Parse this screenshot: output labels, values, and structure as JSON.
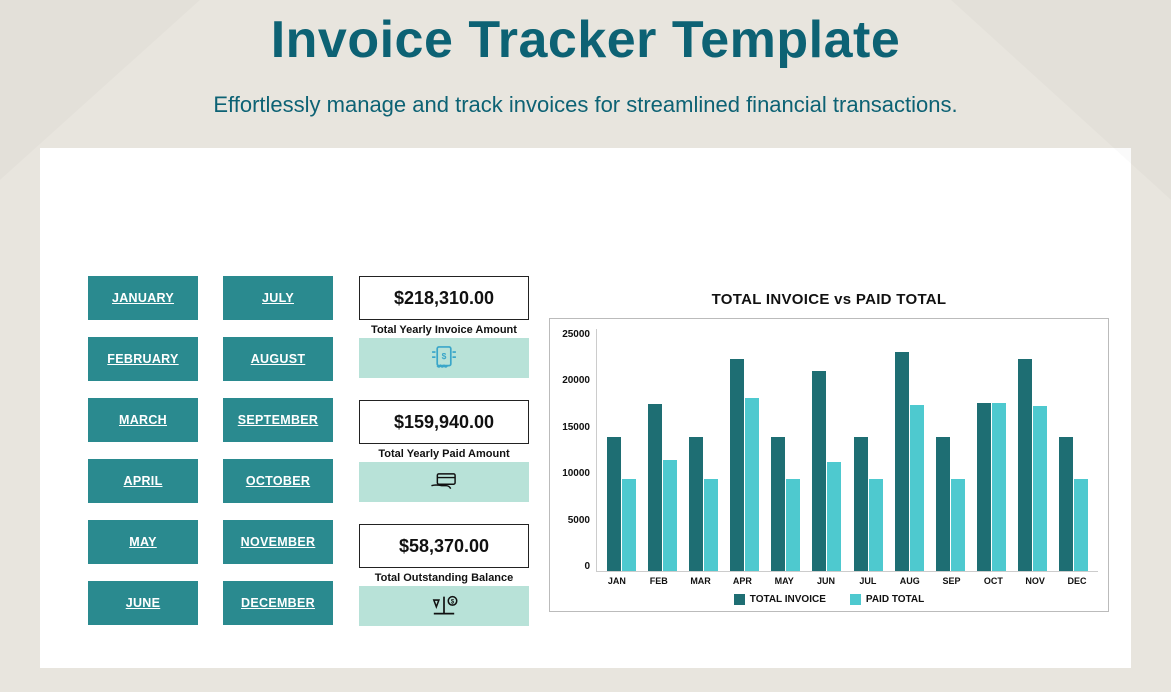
{
  "header": {
    "title": "Invoice Tracker Template",
    "subtitle": "Effortlessly manage and track invoices for streamlined financial transactions."
  },
  "months": {
    "col1": [
      "JANUARY",
      "FEBRUARY",
      "MARCH",
      "APRIL",
      "MAY",
      "JUNE"
    ],
    "col2": [
      "JULY",
      "AUGUST",
      "SEPTEMBER",
      "OCTOBER",
      "NOVEMBER",
      "DECEMBER"
    ]
  },
  "stats": {
    "invoice": {
      "value": "$218,310.00",
      "label": "Total Yearly Invoice Amount"
    },
    "paid": {
      "value": "$159,940.00",
      "label": "Total Yearly Paid Amount"
    },
    "outstanding": {
      "value": "$58,370.00",
      "label": "Total Outstanding Balance"
    }
  },
  "chart_title": "TOTAL INVOICE vs PAID TOTAL",
  "legend": {
    "total": "TOTAL INVOICE",
    "paid": "PAID TOTAL"
  },
  "chart_data": {
    "type": "bar",
    "title": "TOTAL INVOICE vs PAID TOTAL",
    "xlabel": "",
    "ylabel": "",
    "ylim": [
      0,
      25000
    ],
    "yticks": [
      0,
      5000,
      10000,
      15000,
      20000,
      25000
    ],
    "categories": [
      "JAN",
      "FEB",
      "MAR",
      "APR",
      "MAY",
      "JUN",
      "JUL",
      "AUG",
      "SEP",
      "OCT",
      "NOV",
      "DEC"
    ],
    "series": [
      {
        "name": "TOTAL INVOICE",
        "color": "#1e6e73",
        "values": [
          14700,
          18300,
          14700,
          23200,
          14700,
          21900,
          14700,
          24000,
          14700,
          18400,
          23200,
          14700
        ]
      },
      {
        "name": "PAID TOTAL",
        "color": "#4ec9cf",
        "values": [
          10100,
          12200,
          10100,
          19000,
          10100,
          12000,
          10100,
          18200,
          10100,
          18400,
          18100,
          10100
        ]
      }
    ]
  }
}
